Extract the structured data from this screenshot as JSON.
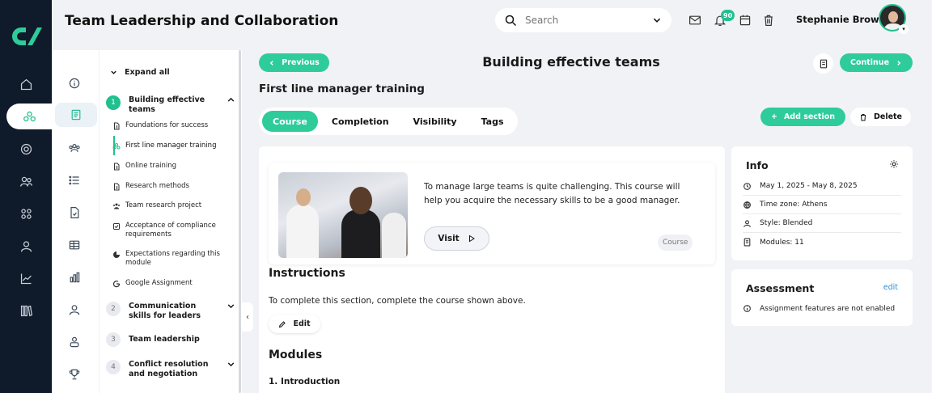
{
  "app": {
    "title": "Team Leadership and Collaboration"
  },
  "header": {
    "search_placeholder": "Search",
    "notification_count": "90",
    "user_name": "Stephanie Brown"
  },
  "tree": {
    "expand_all": "Expand all",
    "modules": [
      {
        "num": "1",
        "title": "Building effective teams"
      },
      {
        "num": "2",
        "title": "Communication skills for leaders"
      },
      {
        "num": "3",
        "title": "Team leadership"
      },
      {
        "num": "4",
        "title": "Conflict resolution and negotiation"
      }
    ],
    "chapters": [
      {
        "label": "Foundations for success",
        "icon": "document-icon"
      },
      {
        "label": "First line manager training",
        "icon": "modules-icon"
      },
      {
        "label": "Online training",
        "icon": "document-icon"
      },
      {
        "label": "Research methods",
        "icon": "document-icon"
      },
      {
        "label": "Team research project",
        "icon": "team-icon"
      },
      {
        "label": "Acceptance of compliance requirements",
        "icon": "checkbox-icon"
      },
      {
        "label": "Expectations regarding this module",
        "icon": "pie-chart-icon"
      },
      {
        "label": "Google Assignment",
        "icon": "google-icon"
      }
    ]
  },
  "nav": {
    "previous": "Previous",
    "continue": "Continue",
    "page_title": "Building effective teams"
  },
  "section": {
    "title": "First line manager training",
    "tabs": [
      "Course",
      "Completion",
      "Visibility",
      "Tags"
    ],
    "active_tab": "Course",
    "add_section": "Add section",
    "delete": "Delete"
  },
  "course": {
    "description": "To manage large teams is quite challenging. This course will help you acquire the necessary skills to be a good manager.",
    "visit_label": "Visit",
    "type_tag": "Course"
  },
  "instructions": {
    "heading": "Instructions",
    "text": "To complete this section, complete the course shown above.",
    "edit_label": "Edit"
  },
  "modules": {
    "heading": "Modules",
    "first": "1. Introduction"
  },
  "info": {
    "heading": "Info",
    "dates": "May 1, 2025 - May 8, 2025",
    "timezone": "Time zone: Athens",
    "style": "Style: Blended",
    "modules": "Modules: 11"
  },
  "assessment": {
    "heading": "Assessment",
    "edit": "edit",
    "note": "Assignment features are not enabled"
  },
  "colors": {
    "accent": "#2ecc9a",
    "rail": "#0f1a2a",
    "link": "#2a8fd6"
  }
}
